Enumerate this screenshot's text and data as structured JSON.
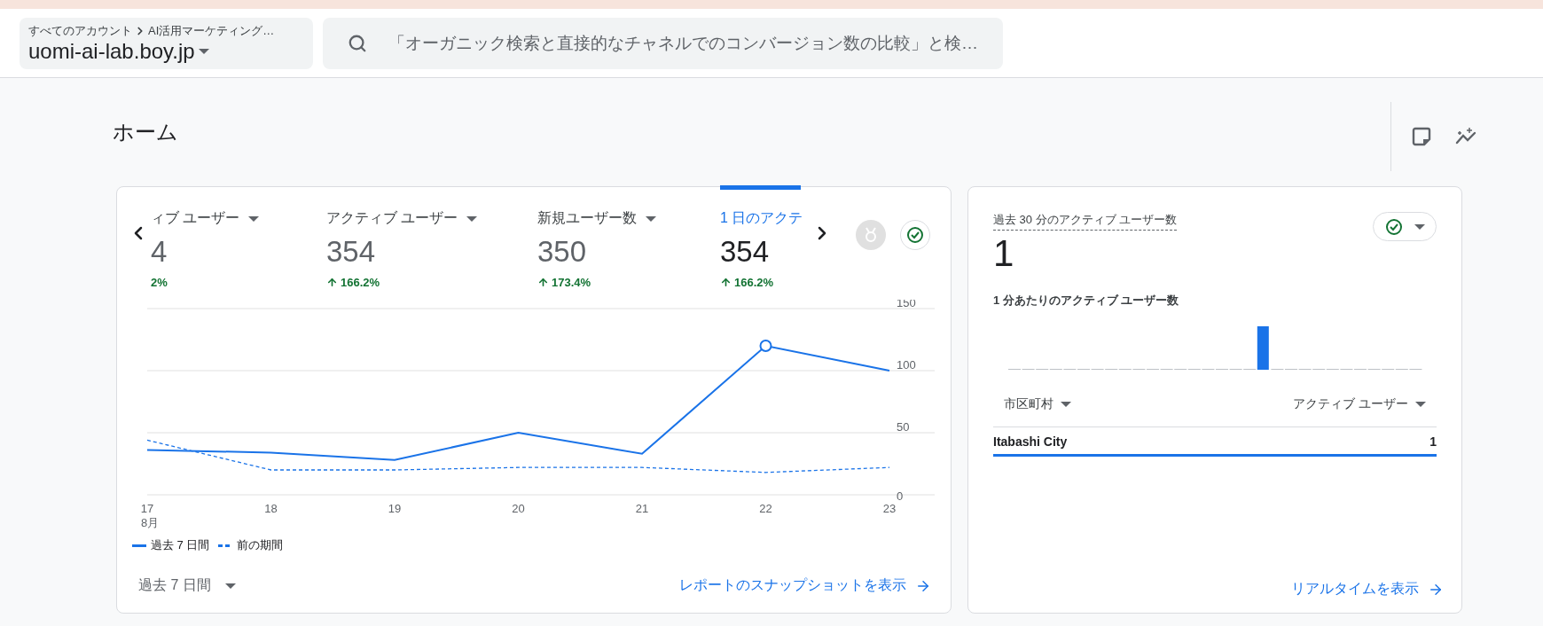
{
  "header": {
    "breadcrumb": {
      "root": "すべてのアカウント",
      "current": "AI活用マーケティング…"
    },
    "property": "uomi-ai-lab.boy.jp",
    "search": {
      "placeholder": "「オーガニック検索と直接的なチャネルでのコンバージョン数の比較」と検…"
    }
  },
  "page": {
    "title": "ホーム"
  },
  "overview_card": {
    "metric_tabs": [
      {
        "label": "ィブ ユーザー",
        "value": "4",
        "change": "2%",
        "has_dropdown": true,
        "show_arrow": false,
        "selected": false
      },
      {
        "label": "アクティブ ユーザー",
        "value": "354",
        "change": "166.2%",
        "has_dropdown": true,
        "show_arrow": true,
        "selected": false
      },
      {
        "label": "新規ユーザー数",
        "value": "350",
        "change": "173.4%",
        "has_dropdown": true,
        "show_arrow": true,
        "selected": false
      },
      {
        "label": "1 日のアクテ",
        "value": "354",
        "change": "166.2%",
        "has_dropdown": false,
        "show_arrow": true,
        "selected": true
      }
    ],
    "month_label": "8月",
    "chart_data": {
      "type": "line",
      "categories": [
        "17",
        "18",
        "19",
        "20",
        "21",
        "22",
        "23"
      ],
      "ylim": [
        0,
        150
      ],
      "yticks": [
        0,
        50,
        100,
        150
      ],
      "series": [
        {
          "name": "過去 7 日間",
          "color": "#1a73e8",
          "line_style": "solid",
          "values": [
            36,
            34,
            28,
            50,
            33,
            120,
            100
          ]
        },
        {
          "name": "前の期間",
          "color": "#1a73e8",
          "line_style": "dashed",
          "values": [
            44,
            20,
            20,
            22,
            22,
            18,
            22
          ]
        }
      ]
    },
    "date_range": "過去 7 日間",
    "link": "レポートのスナップショットを表示"
  },
  "realtime_card": {
    "title": "過去 30 分のアクティブ ユーザー数",
    "value": "1",
    "subtitle": "1 分あたりのアクティブ ユーザー数",
    "table": {
      "columns": [
        "市区町村",
        "アクティブ ユーザー"
      ],
      "rows": [
        {
          "city": "Itabashi City",
          "users": "1"
        }
      ]
    },
    "link": "リアルタイムを表示"
  }
}
